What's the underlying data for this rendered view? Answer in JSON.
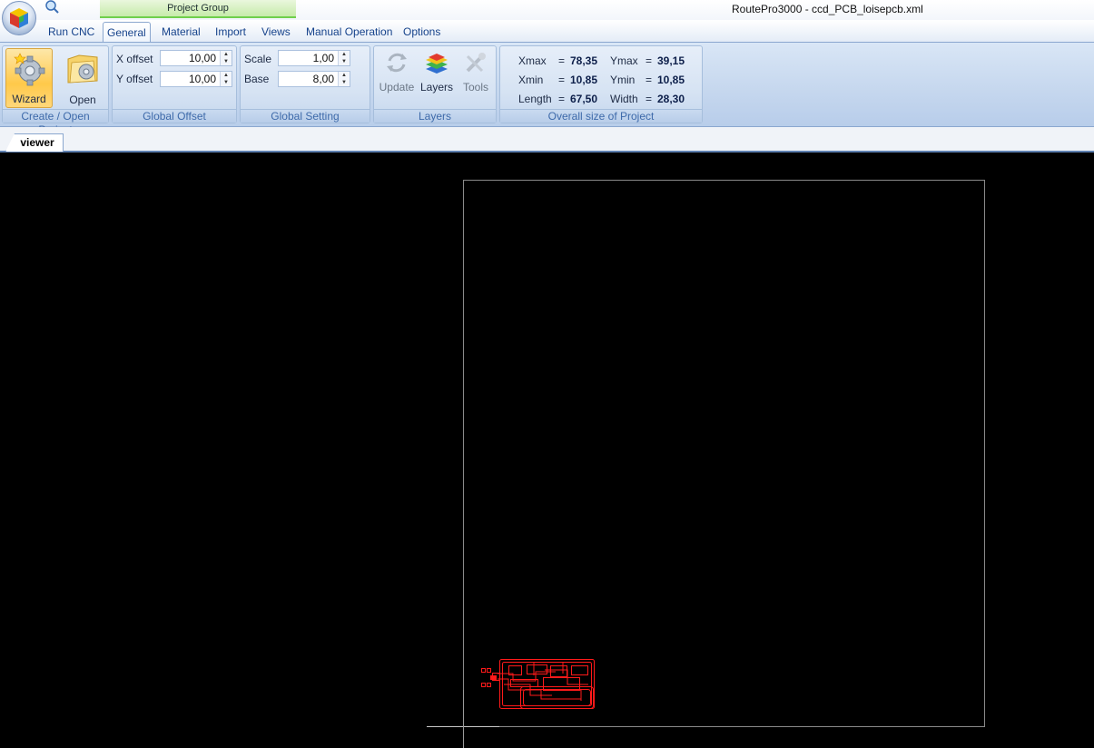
{
  "titlebar": {
    "project_group": "Project Group",
    "window_title": "RoutePro3000 - ccd_PCB_loisepcb.xml"
  },
  "tabs": [
    {
      "label": "Run CNC",
      "active": false
    },
    {
      "label": "General",
      "active": true
    },
    {
      "label": "Material",
      "active": false
    },
    {
      "label": "Import",
      "active": false
    },
    {
      "label": "Views",
      "active": false
    },
    {
      "label": "Manual Operation",
      "active": false
    },
    {
      "label": "Options",
      "active": false
    }
  ],
  "ribbon": {
    "create_open": {
      "label": "Create / Open Project",
      "wizard": "Wizard",
      "open": "Open"
    },
    "global_offset": {
      "label": "Global Offset",
      "x_label": "X offset",
      "x_value": "10,00",
      "y_label": "Y offset",
      "y_value": "10,00"
    },
    "global_setting": {
      "label": "Global Setting",
      "scale_label": "Scale",
      "scale_value": "1,00",
      "base_label": "Base",
      "base_value": "8,00"
    },
    "layers": {
      "label": "Layers",
      "update": "Update",
      "layers": "Layers",
      "tools": "Tools"
    },
    "overall_size": {
      "label": "Overall size of Project",
      "xmax_label": "Xmax",
      "xmax_value": "78,35",
      "ymax_label": "Ymax",
      "ymax_value": "39,15",
      "xmin_label": "Xmin",
      "xmin_value": "10,85",
      "ymin_label": "Ymin",
      "ymin_value": "10,85",
      "length_label": "Length",
      "length_value": "67,50",
      "width_label": "Width",
      "width_value": "28,30",
      "eq": "="
    }
  },
  "document_tab": "viewer",
  "colors": {
    "viewer_bg": "#000000",
    "board_outline": "#8a8a8a",
    "pcb_trace": "#ff1a1a",
    "ribbon_accent": "#15428b"
  }
}
